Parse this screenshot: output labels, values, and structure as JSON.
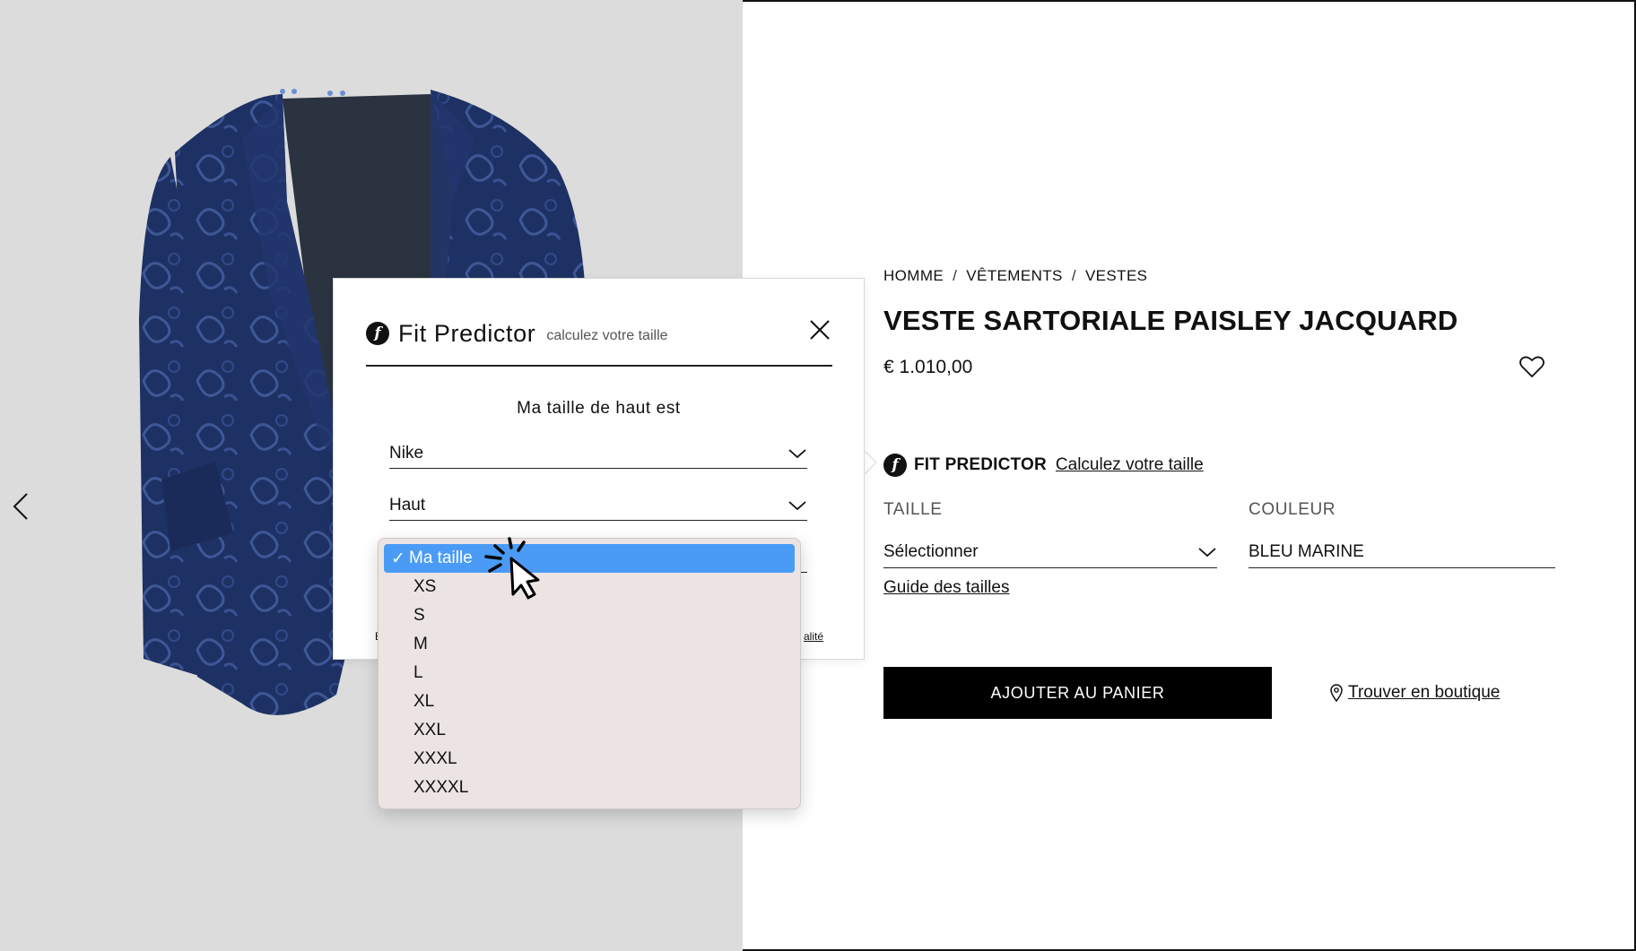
{
  "gallery": {
    "prev_icon": "chevron-left-icon",
    "image_alt": "Veste sartoriale paisley jacquard bleu marine"
  },
  "breadcrumb": {
    "items": [
      "HOMME",
      "VÊTEMENTS",
      "VESTES"
    ],
    "separator": "/"
  },
  "product": {
    "title": "VESTE SARTORIALE PAISLEY JACQUARD",
    "price": "€ 1.010,00",
    "favorite_icon": "heart-icon"
  },
  "fit_predictor": {
    "brand": "FIT PREDICTOR",
    "link": "Calculez votre taille",
    "logo": "f"
  },
  "size": {
    "label": "TAILLE",
    "value": "Sélectionner",
    "guide": "Guide des tailles"
  },
  "color": {
    "label": "COULEUR",
    "value": "BLEU MARINE"
  },
  "actions": {
    "add_to_cart": "AJOUTER AU PANIER",
    "store": "Trouver en boutique",
    "store_icon": "map-pin-icon"
  },
  "popover": {
    "title": "Fit Predictor",
    "subtitle": "calculez votre taille",
    "logo": "f",
    "close_icon": "close-icon",
    "question": "Ma taille de haut est",
    "brand_select": "Nike",
    "type_select": "Haut",
    "footer_left": "E",
    "footer_right": "alité"
  },
  "dropdown": {
    "check": "✓",
    "options": [
      "Ma taille",
      "XS",
      "S",
      "M",
      "L",
      "XL",
      "XXL",
      "XXXL",
      "XXXXL"
    ],
    "selected_index": 0
  },
  "colors": {
    "panel_bg": "#dcdcdc",
    "selection": "#4a9bf6",
    "dropdown_bg": "#ebe4e3",
    "jacket": "#1d2f63"
  }
}
